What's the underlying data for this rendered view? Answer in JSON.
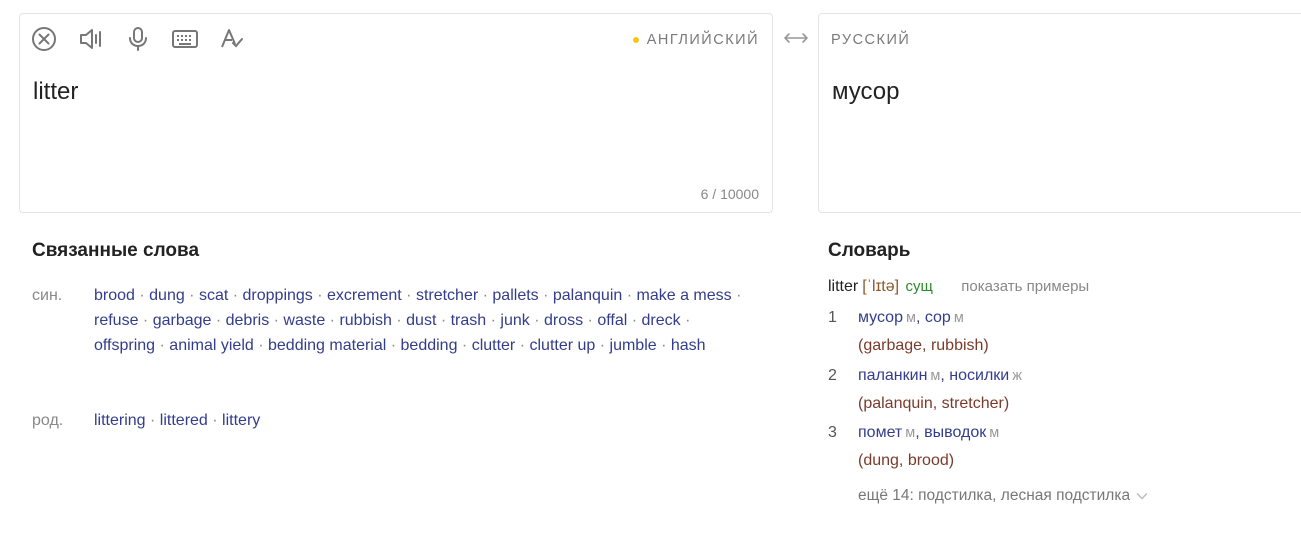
{
  "source": {
    "language": "АНГЛИЙСКИЙ",
    "text": "litter",
    "counter": "6 / 10000",
    "tools": [
      "clear-icon",
      "speaker-icon",
      "microphone-icon",
      "keyboard-icon",
      "spellcheck-icon"
    ]
  },
  "target": {
    "language": "РУССКИЙ",
    "text": "мусор"
  },
  "related": {
    "title": "Связанные слова",
    "rows": [
      {
        "label": "син.",
        "words": [
          "brood",
          "dung",
          "scat",
          "droppings",
          "excrement",
          "stretcher",
          "pallets",
          "palanquin",
          "make a mess",
          "refuse",
          "garbage",
          "debris",
          "waste",
          "rubbish",
          "dust",
          "trash",
          "junk",
          "dross",
          "offal",
          "dreck",
          "offspring",
          "animal yield",
          "bedding material",
          "bedding",
          "clutter",
          "clutter up",
          "jumble",
          "hash"
        ]
      },
      {
        "label": "род.",
        "words": [
          "littering",
          "littered",
          "littery"
        ]
      }
    ]
  },
  "dictionary": {
    "title": "Словарь",
    "word": "litter",
    "ipa": "[ˈlɪtə]",
    "pos": "сущ",
    "examples_link": "показать примеры",
    "senses": [
      {
        "num": "1",
        "translations": [
          {
            "word": "мусор",
            "gender": "м"
          },
          {
            "word": "сор",
            "gender": "м"
          }
        ],
        "originals": "(garbage, rubbish)"
      },
      {
        "num": "2",
        "translations": [
          {
            "word": "паланкин",
            "gender": "м"
          },
          {
            "word": "носилки",
            "gender": "ж"
          }
        ],
        "originals": "(palanquin, stretcher)"
      },
      {
        "num": "3",
        "translations": [
          {
            "word": "помет",
            "gender": "м"
          },
          {
            "word": "выводок",
            "gender": "м"
          }
        ],
        "originals": "(dung, brood)"
      }
    ],
    "more": "ещё 14: подстилка, лесная подстилка"
  },
  "colors": {
    "accent_dot": "#f5c518",
    "link": "#333d8c",
    "original": "#7a3b2a",
    "pos": "#2a8a2a"
  }
}
